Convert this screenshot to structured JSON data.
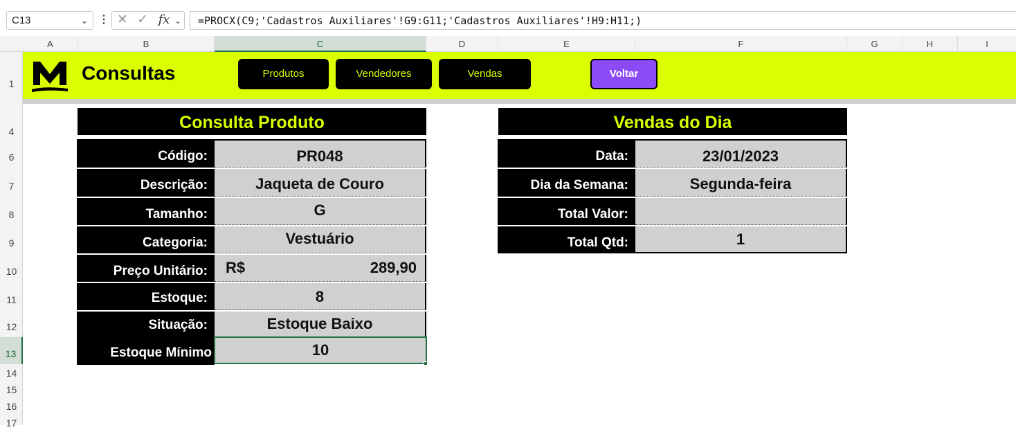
{
  "formula_bar": {
    "name_box": "C13",
    "chevron": "⌄",
    "dots": "⋮",
    "cancel_icon": "✕",
    "enter_icon": "✓",
    "fx_label": "fx",
    "formula": "=PROCX(C9;'Cadastros Auxiliares'!G9:G11;'Cadastros Auxiliares'!H9:H11;)"
  },
  "columns": [
    "A",
    "B",
    "C",
    "D",
    "E",
    "F",
    "G",
    "H",
    "I"
  ],
  "selected_column": "C",
  "rows": [
    "1",
    "4",
    "6",
    "7",
    "8",
    "9",
    "10",
    "11",
    "12",
    "13",
    "14",
    "15",
    "16",
    "17"
  ],
  "selected_row": "13",
  "banner": {
    "title": "Consultas",
    "buttons": [
      "Produtos",
      "Vendedores",
      "Vendas"
    ],
    "back_button": "Voltar",
    "accent": "#d9ff00",
    "back_color": "#8b4cf7"
  },
  "consulta_produto": {
    "title": "Consulta Produto",
    "rows": [
      {
        "label": "Código:",
        "value": "PR048"
      },
      {
        "label": "Descrição:",
        "value": "Jaqueta de Couro"
      },
      {
        "label": "Tamanho:",
        "value": "G"
      },
      {
        "label": "Categoria:",
        "value": "Vestuário"
      },
      {
        "label": "Preço Unitário:",
        "currency": "R$",
        "value": "289,90"
      },
      {
        "label": "Estoque:",
        "value": "8"
      },
      {
        "label": "Situação:",
        "value": "Estoque Baixo"
      },
      {
        "label": "Estoque Mínimo",
        "value": "10"
      }
    ]
  },
  "vendas_do_dia": {
    "title": "Vendas do Dia",
    "rows": [
      {
        "label": "Data:",
        "value": "23/01/2023"
      },
      {
        "label": "Dia da Semana:",
        "value": "Segunda-feira"
      },
      {
        "label": "Total Valor:",
        "value": ""
      },
      {
        "label": "Total Qtd:",
        "value": "1"
      }
    ]
  }
}
